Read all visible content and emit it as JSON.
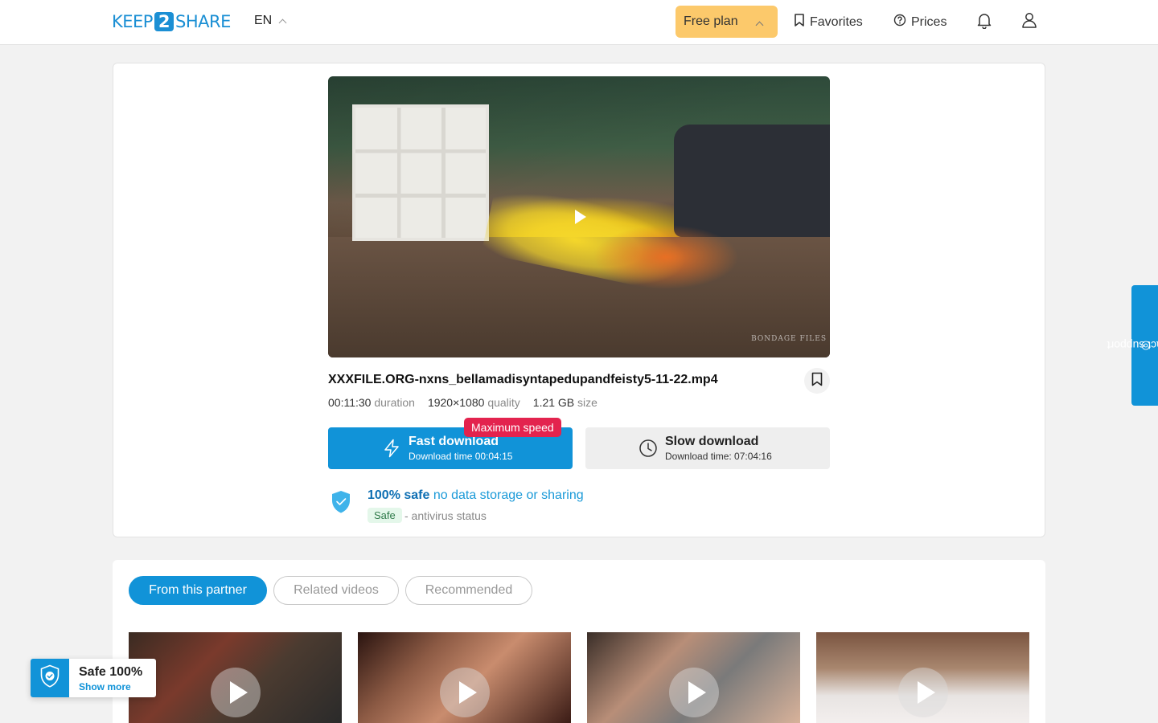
{
  "header": {
    "logo_left": "KEEP",
    "logo_mid": "2",
    "logo_right": "SHARE",
    "lang": "EN",
    "plan": "Free plan",
    "favorites": "Favorites",
    "prices": "Prices"
  },
  "video": {
    "watermark": "BONDAGE FILES"
  },
  "file": {
    "name": "XXXFILE.ORG-nxns_bellamadisyntapedupandfeisty5-11-22.mp4",
    "duration_value": "00:11:30",
    "duration_label": "duration",
    "quality_value": "1920×1080",
    "quality_label": "quality",
    "size_value": "1.21 GB",
    "size_label": "size"
  },
  "downloads": {
    "fast_title": "Fast download",
    "fast_time": "Download time 00:04:15",
    "badge": "Maximum speed",
    "slow_title": "Slow download",
    "slow_time": "Download time: 07:04:16"
  },
  "safety": {
    "title_bold": "100% safe",
    "title_rest": "no data storage or sharing",
    "tag": "Safe",
    "status": "- antivirus status"
  },
  "related": {
    "tabs": [
      "From this partner",
      "Related videos",
      "Recommended"
    ]
  },
  "safe_widget": {
    "title": "Safe 100%",
    "link": "Show more"
  },
  "support": "contact support",
  "colors": {
    "accent": "#1193d8",
    "plan": "#fcc96b",
    "badge": "#e3234e"
  }
}
